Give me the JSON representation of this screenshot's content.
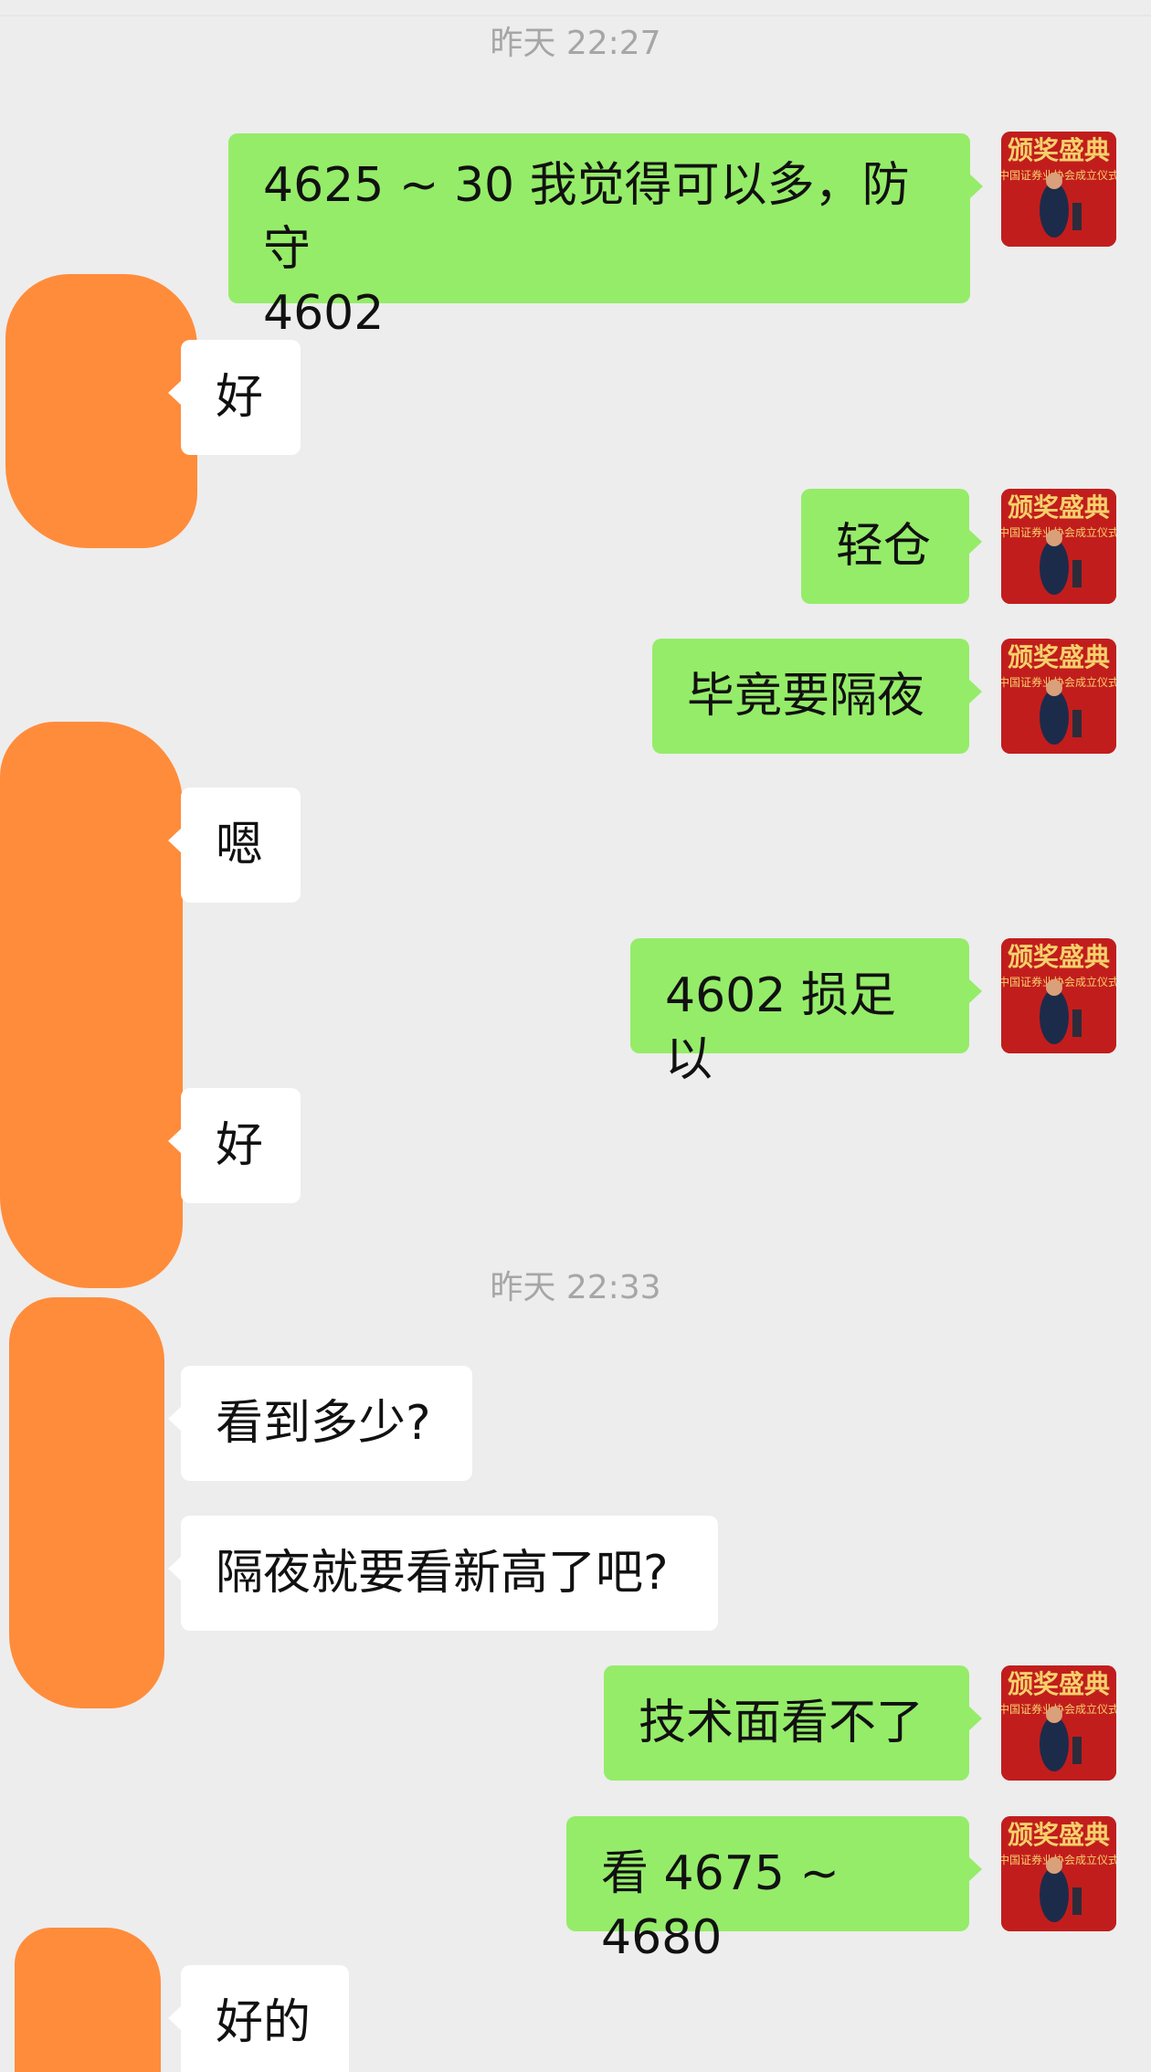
{
  "chat": {
    "timestamps": [
      "昨天 22:27",
      "昨天 22:33"
    ],
    "messages": [
      {
        "from": "me",
        "text": "4625 ~ 30 我觉得可以多，防守\n4602"
      },
      {
        "from": "them",
        "text": "好"
      },
      {
        "from": "me",
        "text": "轻仓"
      },
      {
        "from": "me",
        "text": "毕竟要隔夜"
      },
      {
        "from": "them",
        "text": "嗯"
      },
      {
        "from": "me",
        "text": "4602 损足以"
      },
      {
        "from": "them",
        "text": "好"
      },
      {
        "from": "them",
        "text": "看到多少?"
      },
      {
        "from": "them",
        "text": "隔夜就要看新高了吧?"
      },
      {
        "from": "me",
        "text": "技术面看不了"
      },
      {
        "from": "me",
        "text": "看 4675 ~ 4680"
      },
      {
        "from": "them",
        "text": "好的"
      }
    ]
  },
  "avatar_self": {
    "banner_text": "颁奖盛典",
    "subtitle_text": "中国证券业协会成立仪式"
  },
  "colors": {
    "background": "#ededed",
    "bubble_me": "#95ec69",
    "bubble_them": "#ffffff",
    "redaction": "#ff8c3b",
    "timestamp": "#a6a6a6",
    "avatar_red": "#c21d1d",
    "avatar_gold": "#f4d06b"
  }
}
